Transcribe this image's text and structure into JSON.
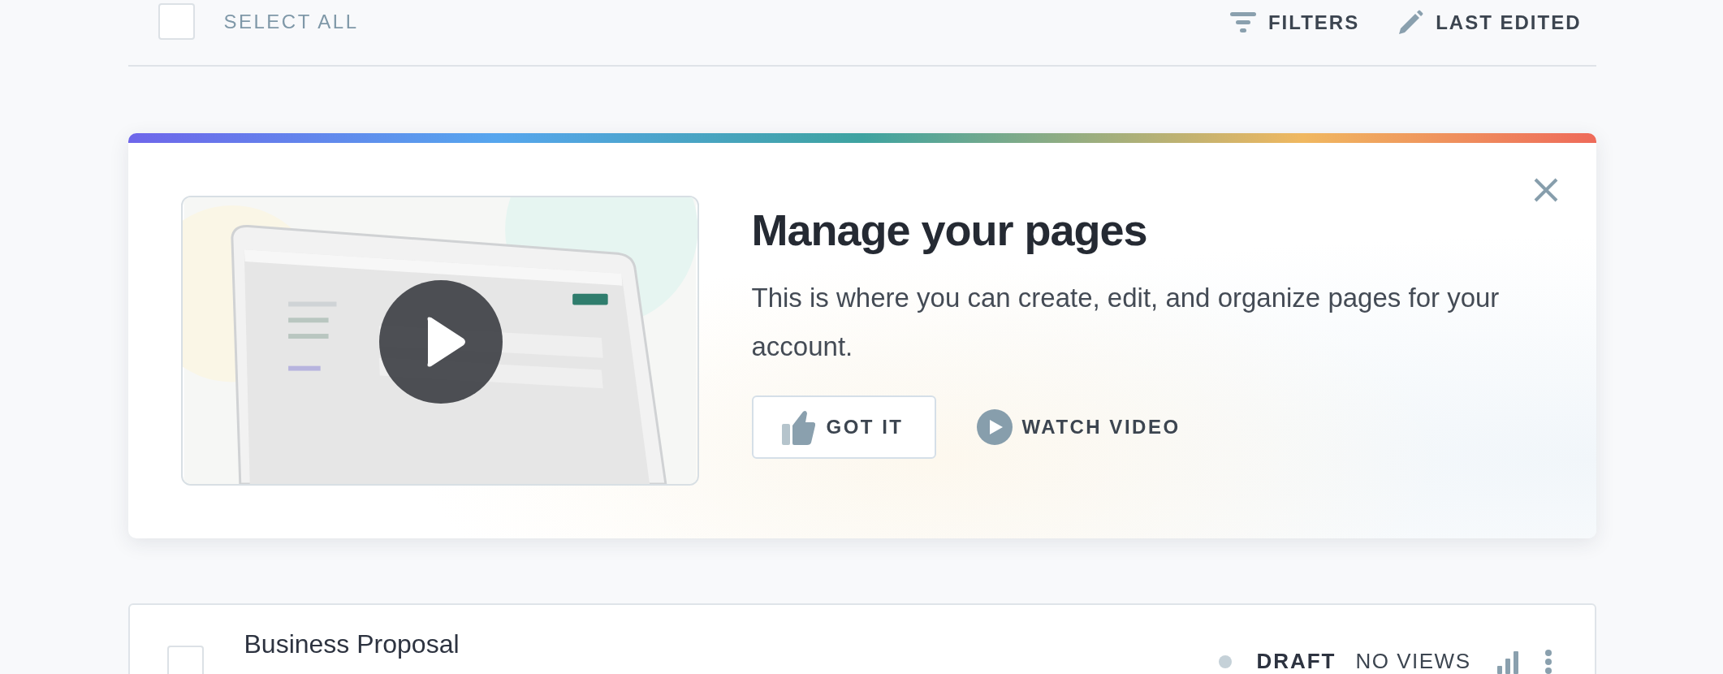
{
  "toolbar": {
    "select_all": {
      "label": "SELECT ALL",
      "checked": false
    },
    "filters": "FILTERS",
    "sort": "LAST EDITED"
  },
  "intro_card": {
    "title": "Manage your pages",
    "body": "This is where you can create, edit, and organize pages for your account.",
    "buttons": [
      {
        "kind": "outlined",
        "label": "GOT IT"
      },
      {
        "kind": "video",
        "label": "WATCH VIDEO"
      }
    ]
  },
  "pages": [
    {
      "title": "Business Proposal",
      "checked": false,
      "status": "DRAFT",
      "views": "NO VIEWS"
    }
  ]
}
